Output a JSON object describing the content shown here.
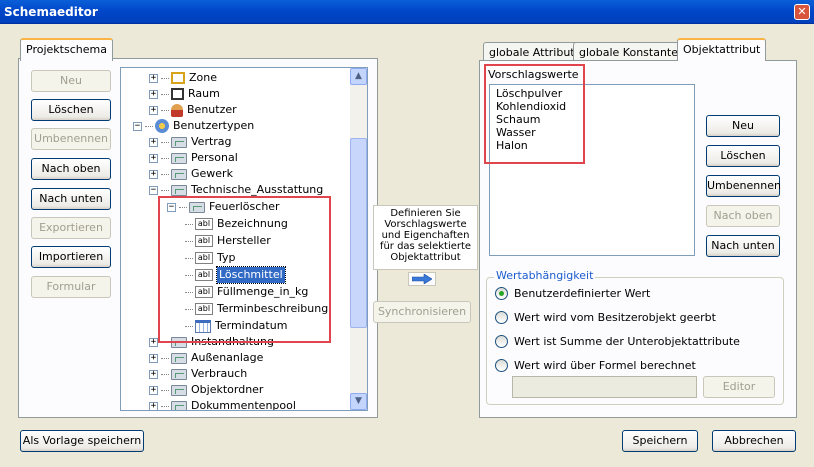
{
  "window": {
    "title": "Schemaeditor"
  },
  "left_panel": {
    "tab": "Projektschema",
    "buttons": {
      "neu": "Neu",
      "loeschen": "Löschen",
      "umbenennen": "Umbenennen",
      "nach_oben": "Nach oben",
      "nach_unten": "Nach unten",
      "exportieren": "Exportieren",
      "importieren": "Importieren",
      "formular": "Formular"
    },
    "tree": {
      "zone": "Zone",
      "raum": "Raum",
      "benutzer": "Benutzer",
      "benutzertypen": "Benutzertypen",
      "vertrag": "Vertrag",
      "personal": "Personal",
      "gewerk": "Gewerk",
      "technische_ausstattung": "Technische_Ausstattung",
      "feuerloescher": "Feuerlöscher",
      "attributes": [
        {
          "icon": "abl",
          "label": "Bezeichnung"
        },
        {
          "icon": "abl",
          "label": "Hersteller"
        },
        {
          "icon": "abl",
          "label": "Typ"
        },
        {
          "icon": "abl",
          "label": "Löschmittel"
        },
        {
          "icon": "abl",
          "label": "Füllmenge_in_kg"
        },
        {
          "icon": "abl",
          "label": "Terminbeschreibung"
        },
        {
          "icon": "date",
          "label": "Termindatum"
        }
      ],
      "after": [
        "Instandhaltung",
        "Außenanlage",
        "Verbrauch",
        "Objektordner",
        "Dokummentenpool"
      ]
    }
  },
  "middle": {
    "info": [
      "Definieren Sie",
      "Vorschlagswerte",
      "und Eigenchaften",
      "für das selektierte",
      "Objektattribut"
    ],
    "sync_button": "Synchronisieren"
  },
  "right_panel": {
    "tabs": [
      "globale Attribute",
      "globale Konstanten",
      "Objektattribut"
    ],
    "vorschlag_label": "Vorschlagswerte",
    "vorschlag_items": [
      "Löschpulver",
      "Kohlendioxid",
      "Schaum",
      "Wasser",
      "Halon"
    ],
    "buttons": {
      "neu": "Neu",
      "loeschen": "Löschen",
      "umbenennen": "Umbenennen",
      "nach_oben": "Nach oben",
      "nach_unten": "Nach unten"
    },
    "group_label": "Wertabhängigkeit",
    "radios": [
      "Benutzerdefinierter Wert",
      "Wert wird vom Besitzerobjekt geerbt",
      "Wert ist Summe der Unterobjektattribute",
      "Wert wird über Formel berechnet"
    ],
    "editor_button": "Editor"
  },
  "footer": {
    "vorlage": "Als Vorlage speichern",
    "speichern": "Speichern",
    "abbrechen": "Abbrechen"
  }
}
